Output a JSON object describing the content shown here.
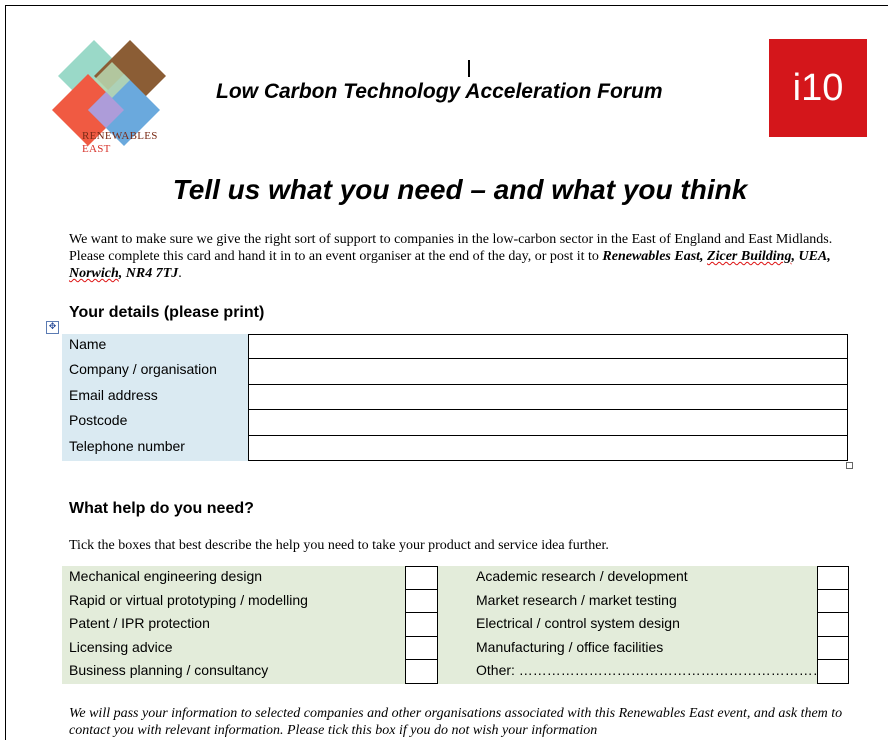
{
  "header": {
    "logo_line1": "RENEWABLES",
    "logo_line2": "EAST",
    "forum_title": "Low Carbon Technology Acceleration Forum",
    "badge": "i10"
  },
  "main_title": "Tell us what you need – and what you think",
  "intro": {
    "text": "We want to make sure we give the right sort of support to companies in the low-carbon sector in the East of England and East Midlands. Please complete this card and hand it in to an event organiser at the end of the day, or post it to ",
    "address_part1": "Renewables East, ",
    "address_part2": "Zicer Building",
    "address_part3": ", UEA, ",
    "address_part4": "Norwich",
    "address_part5": ", NR4 7TJ",
    "end": "."
  },
  "details": {
    "heading": "Your details (please print)",
    "fields": [
      "Name",
      "Company / organisation",
      "Email address",
      "Postcode",
      "Telephone number"
    ]
  },
  "help": {
    "heading": "What help do you need?",
    "instruction": "Tick the boxes that best describe the help you need to take your product and service idea further.",
    "left": [
      "Mechanical engineering  design",
      "Rapid or virtual prototyping / modelling",
      "Patent / IPR protection",
      "Licensing advice",
      "Business planning / consultancy"
    ],
    "right": [
      "Academic research  / development",
      "Market research  / market testing",
      "Electrical / control system design",
      "Manufacturing / office facilities",
      "Other: …………………………………………………………………………………"
    ]
  },
  "footer": "We will pass your information to selected companies and other organisations associated with this Renewables East event, and ask them to contact you with relevant information. Please tick this box if you do not wish your information"
}
